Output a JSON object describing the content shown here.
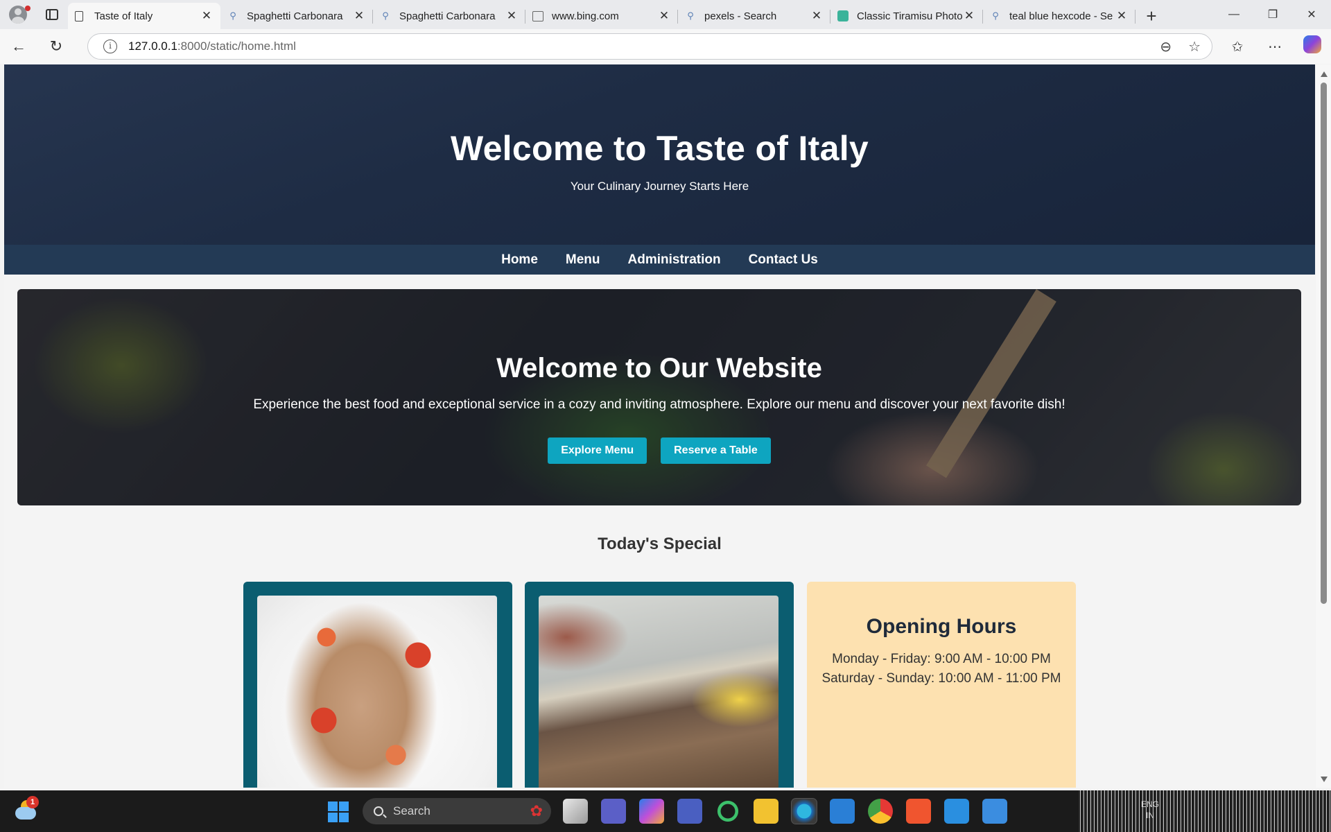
{
  "browser": {
    "tabs": [
      {
        "title": "Taste of Italy",
        "icon": "page-icon",
        "active": true
      },
      {
        "title": "Spaghetti Carbonara",
        "icon": "search-icon"
      },
      {
        "title": "Spaghetti Carbonara",
        "icon": "search-icon"
      },
      {
        "title": "www.bing.com",
        "icon": "bing-icon"
      },
      {
        "title": "pexels - Search",
        "icon": "search-icon"
      },
      {
        "title": "Classic Tiramisu Photo",
        "icon": "site-icon"
      },
      {
        "title": "teal blue hexcode - Se",
        "icon": "search-icon"
      }
    ],
    "url_host": "127.0.0.1",
    "url_rest": ":8000/static/home.html"
  },
  "site": {
    "header_title": "Welcome to Taste of Italy",
    "header_subtitle": "Your Culinary Journey Starts Here",
    "nav": [
      "Home",
      "Menu",
      "Administration",
      "Contact Us"
    ],
    "hero": {
      "title": "Welcome to Our Website",
      "text": "Experience the best food and exceptional service in a cozy and inviting atmosphere. Explore our menu and discover your next favorite dish!",
      "button_primary": "Explore Menu",
      "button_secondary": "Reserve a Table"
    },
    "special_title": "Today's Special",
    "hours": {
      "title": "Opening Hours",
      "weekdays": "Monday - Friday: 9:00 AM - 10:00 PM",
      "weekend": "Saturday - Sunday: 10:00 AM - 11:00 PM"
    }
  },
  "taskbar": {
    "search_placeholder": "Search",
    "weather_badge": "1",
    "lang_line1": "ENG",
    "lang_line2": "IN"
  },
  "colors": {
    "header_bg": "#1e2c44",
    "nav_bg": "#233a55",
    "accent_button": "#0ea5c0",
    "dish_card_bg": "#0b5d70",
    "hours_card_bg": "#fde1b0"
  }
}
